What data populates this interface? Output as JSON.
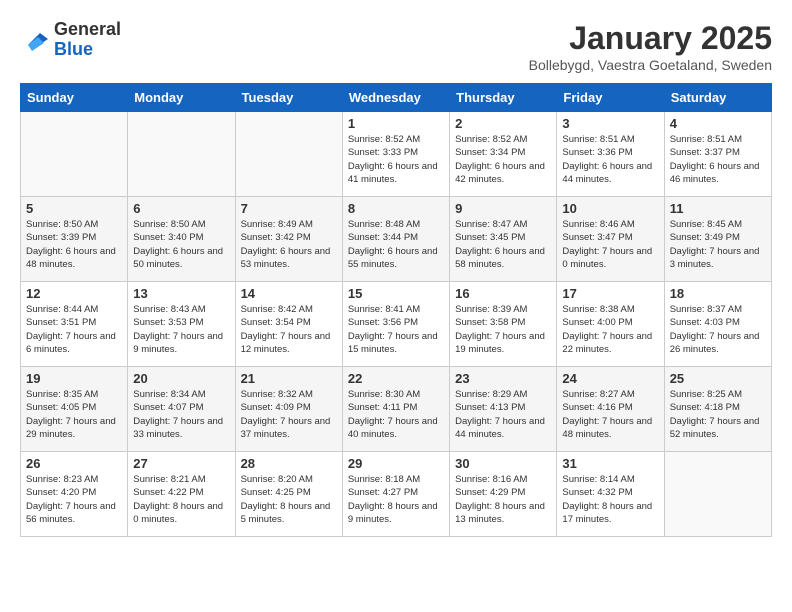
{
  "header": {
    "logo_line1": "General",
    "logo_line2": "Blue",
    "month_title": "January 2025",
    "subtitle": "Bollebygd, Vaestra Goetaland, Sweden"
  },
  "weekdays": [
    "Sunday",
    "Monday",
    "Tuesday",
    "Wednesday",
    "Thursday",
    "Friday",
    "Saturday"
  ],
  "weeks": [
    [
      {
        "day": "",
        "sunrise": "",
        "sunset": "",
        "daylight": ""
      },
      {
        "day": "",
        "sunrise": "",
        "sunset": "",
        "daylight": ""
      },
      {
        "day": "",
        "sunrise": "",
        "sunset": "",
        "daylight": ""
      },
      {
        "day": "1",
        "sunrise": "Sunrise: 8:52 AM",
        "sunset": "Sunset: 3:33 PM",
        "daylight": "Daylight: 6 hours and 41 minutes."
      },
      {
        "day": "2",
        "sunrise": "Sunrise: 8:52 AM",
        "sunset": "Sunset: 3:34 PM",
        "daylight": "Daylight: 6 hours and 42 minutes."
      },
      {
        "day": "3",
        "sunrise": "Sunrise: 8:51 AM",
        "sunset": "Sunset: 3:36 PM",
        "daylight": "Daylight: 6 hours and 44 minutes."
      },
      {
        "day": "4",
        "sunrise": "Sunrise: 8:51 AM",
        "sunset": "Sunset: 3:37 PM",
        "daylight": "Daylight: 6 hours and 46 minutes."
      }
    ],
    [
      {
        "day": "5",
        "sunrise": "Sunrise: 8:50 AM",
        "sunset": "Sunset: 3:39 PM",
        "daylight": "Daylight: 6 hours and 48 minutes."
      },
      {
        "day": "6",
        "sunrise": "Sunrise: 8:50 AM",
        "sunset": "Sunset: 3:40 PM",
        "daylight": "Daylight: 6 hours and 50 minutes."
      },
      {
        "day": "7",
        "sunrise": "Sunrise: 8:49 AM",
        "sunset": "Sunset: 3:42 PM",
        "daylight": "Daylight: 6 hours and 53 minutes."
      },
      {
        "day": "8",
        "sunrise": "Sunrise: 8:48 AM",
        "sunset": "Sunset: 3:44 PM",
        "daylight": "Daylight: 6 hours and 55 minutes."
      },
      {
        "day": "9",
        "sunrise": "Sunrise: 8:47 AM",
        "sunset": "Sunset: 3:45 PM",
        "daylight": "Daylight: 6 hours and 58 minutes."
      },
      {
        "day": "10",
        "sunrise": "Sunrise: 8:46 AM",
        "sunset": "Sunset: 3:47 PM",
        "daylight": "Daylight: 7 hours and 0 minutes."
      },
      {
        "day": "11",
        "sunrise": "Sunrise: 8:45 AM",
        "sunset": "Sunset: 3:49 PM",
        "daylight": "Daylight: 7 hours and 3 minutes."
      }
    ],
    [
      {
        "day": "12",
        "sunrise": "Sunrise: 8:44 AM",
        "sunset": "Sunset: 3:51 PM",
        "daylight": "Daylight: 7 hours and 6 minutes."
      },
      {
        "day": "13",
        "sunrise": "Sunrise: 8:43 AM",
        "sunset": "Sunset: 3:53 PM",
        "daylight": "Daylight: 7 hours and 9 minutes."
      },
      {
        "day": "14",
        "sunrise": "Sunrise: 8:42 AM",
        "sunset": "Sunset: 3:54 PM",
        "daylight": "Daylight: 7 hours and 12 minutes."
      },
      {
        "day": "15",
        "sunrise": "Sunrise: 8:41 AM",
        "sunset": "Sunset: 3:56 PM",
        "daylight": "Daylight: 7 hours and 15 minutes."
      },
      {
        "day": "16",
        "sunrise": "Sunrise: 8:39 AM",
        "sunset": "Sunset: 3:58 PM",
        "daylight": "Daylight: 7 hours and 19 minutes."
      },
      {
        "day": "17",
        "sunrise": "Sunrise: 8:38 AM",
        "sunset": "Sunset: 4:00 PM",
        "daylight": "Daylight: 7 hours and 22 minutes."
      },
      {
        "day": "18",
        "sunrise": "Sunrise: 8:37 AM",
        "sunset": "Sunset: 4:03 PM",
        "daylight": "Daylight: 7 hours and 26 minutes."
      }
    ],
    [
      {
        "day": "19",
        "sunrise": "Sunrise: 8:35 AM",
        "sunset": "Sunset: 4:05 PM",
        "daylight": "Daylight: 7 hours and 29 minutes."
      },
      {
        "day": "20",
        "sunrise": "Sunrise: 8:34 AM",
        "sunset": "Sunset: 4:07 PM",
        "daylight": "Daylight: 7 hours and 33 minutes."
      },
      {
        "day": "21",
        "sunrise": "Sunrise: 8:32 AM",
        "sunset": "Sunset: 4:09 PM",
        "daylight": "Daylight: 7 hours and 37 minutes."
      },
      {
        "day": "22",
        "sunrise": "Sunrise: 8:30 AM",
        "sunset": "Sunset: 4:11 PM",
        "daylight": "Daylight: 7 hours and 40 minutes."
      },
      {
        "day": "23",
        "sunrise": "Sunrise: 8:29 AM",
        "sunset": "Sunset: 4:13 PM",
        "daylight": "Daylight: 7 hours and 44 minutes."
      },
      {
        "day": "24",
        "sunrise": "Sunrise: 8:27 AM",
        "sunset": "Sunset: 4:16 PM",
        "daylight": "Daylight: 7 hours and 48 minutes."
      },
      {
        "day": "25",
        "sunrise": "Sunrise: 8:25 AM",
        "sunset": "Sunset: 4:18 PM",
        "daylight": "Daylight: 7 hours and 52 minutes."
      }
    ],
    [
      {
        "day": "26",
        "sunrise": "Sunrise: 8:23 AM",
        "sunset": "Sunset: 4:20 PM",
        "daylight": "Daylight: 7 hours and 56 minutes."
      },
      {
        "day": "27",
        "sunrise": "Sunrise: 8:21 AM",
        "sunset": "Sunset: 4:22 PM",
        "daylight": "Daylight: 8 hours and 0 minutes."
      },
      {
        "day": "28",
        "sunrise": "Sunrise: 8:20 AM",
        "sunset": "Sunset: 4:25 PM",
        "daylight": "Daylight: 8 hours and 5 minutes."
      },
      {
        "day": "29",
        "sunrise": "Sunrise: 8:18 AM",
        "sunset": "Sunset: 4:27 PM",
        "daylight": "Daylight: 8 hours and 9 minutes."
      },
      {
        "day": "30",
        "sunrise": "Sunrise: 8:16 AM",
        "sunset": "Sunset: 4:29 PM",
        "daylight": "Daylight: 8 hours and 13 minutes."
      },
      {
        "day": "31",
        "sunrise": "Sunrise: 8:14 AM",
        "sunset": "Sunset: 4:32 PM",
        "daylight": "Daylight: 8 hours and 17 minutes."
      },
      {
        "day": "",
        "sunrise": "",
        "sunset": "",
        "daylight": ""
      }
    ]
  ]
}
